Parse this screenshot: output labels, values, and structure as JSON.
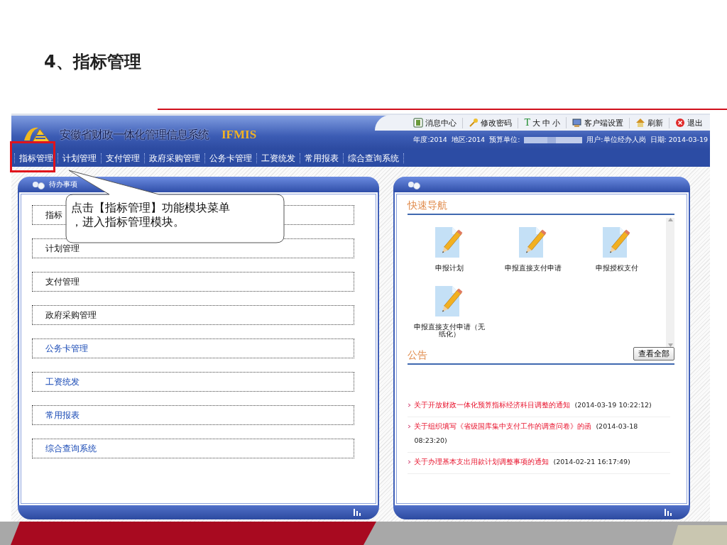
{
  "slide": {
    "title": "4、指标管理"
  },
  "app": {
    "system_name": "安徽省财政一体化管理信息系统",
    "brand": "IFMIS",
    "toolbar": [
      {
        "kind": "message",
        "label": "消息中心"
      },
      {
        "kind": "key",
        "label": "修改密码"
      },
      {
        "kind": "font",
        "glyph": "T",
        "options": [
          "大",
          "中",
          "小"
        ]
      },
      {
        "kind": "settings",
        "label": "客户端设置"
      },
      {
        "kind": "home",
        "label": "刷新"
      },
      {
        "kind": "exit",
        "label": "退出"
      }
    ],
    "info": [
      {
        "kind": "text",
        "text": "年度:2014"
      },
      {
        "kind": "text",
        "text": "地区:2014"
      },
      {
        "kind": "text",
        "text": "预算单位:"
      },
      {
        "kind": "redacted"
      },
      {
        "kind": "text",
        "text": "用户:单位经办人岗"
      },
      {
        "kind": "text",
        "text": "日期: 2014-03-19"
      }
    ],
    "nav": [
      {
        "label": "指标管理",
        "highlighted": true
      },
      {
        "label": "计划管理",
        "highlighted": false
      },
      {
        "label": "支付管理",
        "highlighted": false
      },
      {
        "label": "政府采购管理",
        "highlighted": false
      },
      {
        "label": "公务卡管理",
        "highlighted": false
      },
      {
        "label": "工资统发",
        "highlighted": false
      },
      {
        "label": "常用报表",
        "highlighted": false
      },
      {
        "label": "综合查询系统",
        "highlighted": false
      }
    ],
    "todo_panel": {
      "title": "待办事项",
      "items": [
        {
          "label": "指标",
          "kind": "plain"
        },
        {
          "label": "计划管理",
          "kind": "plain"
        },
        {
          "label": "支付管理",
          "kind": "plain"
        },
        {
          "label": "政府采购管理",
          "kind": "plain"
        },
        {
          "label": "公务卡管理",
          "kind": "link"
        },
        {
          "label": "工资统发",
          "kind": "link"
        },
        {
          "label": "常用报表",
          "kind": "link"
        },
        {
          "label": "综合查询系统",
          "kind": "link"
        }
      ]
    },
    "quick_panel": {
      "quick_nav": {
        "title": "快速导航",
        "items": [
          "申报计划",
          "申报直接支付申请",
          "申报授权支付",
          "申报直接支付申请（无纸化）"
        ]
      },
      "notices": {
        "title": "公告",
        "button": "查看全部",
        "items": [
          {
            "title": "关于开放财政一体化预算指标经济科目调整的通知",
            "time": "(2014-03-19 10:22:12)"
          },
          {
            "title": "关于组织填写《省级国库集中支付工作的调查问卷》的函",
            "time": "(2014-03-18 08:23:20)"
          },
          {
            "title": "关于办理基本支出用款计划调整事项的通知",
            "time": "(2014-02-21 16:17:49)"
          }
        ]
      }
    }
  },
  "callout": {
    "lines": [
      "点击【指标管理】功能模块菜单",
      "，进入指标管理模块。"
    ]
  }
}
